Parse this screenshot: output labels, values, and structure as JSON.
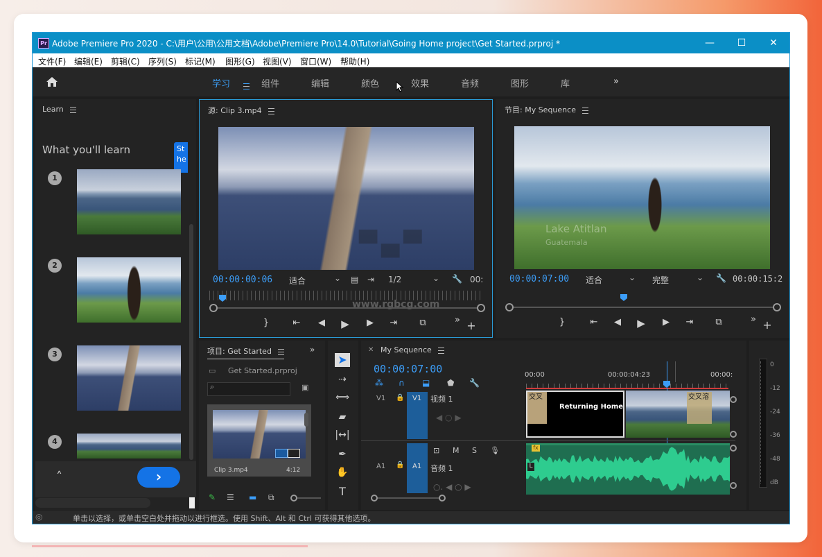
{
  "window": {
    "title": "Adobe Premiere Pro 2020 - C:\\用户\\公用\\公用文档\\Adobe\\Premiere Pro\\14.0\\Tutorial\\Going Home project\\Get Started.prproj *",
    "app_icon": "Pr",
    "controls": {
      "minimize": "—",
      "maximize": "☐",
      "close": "✕"
    }
  },
  "menu": [
    "文件(F)",
    "编辑(E)",
    "剪辑(C)",
    "序列(S)",
    "标记(M)",
    "图形(G)",
    "视图(V)",
    "窗口(W)",
    "帮助(H)"
  ],
  "workspaces": {
    "active": "学习",
    "items": [
      "组件",
      "编辑",
      "颜色",
      "效果",
      "音频",
      "图形",
      "库"
    ],
    "more": "»"
  },
  "learn_panel": {
    "title": "Learn",
    "heading": "What you'll learn",
    "tooltip": "St he",
    "steps": [
      "1",
      "2",
      "3",
      "4"
    ],
    "up_icon": "˄",
    "next_icon": "›"
  },
  "source_monitor": {
    "title": "源: Clip 3.mp4",
    "timecode": "00:00:00:06",
    "fit": "适合",
    "resolution": "1/2",
    "duration_partial": "00:",
    "watermark": "www.rgbcg.com"
  },
  "program_monitor": {
    "title": "节目: My Sequence",
    "timecode": "00:00:07:00",
    "fit": "适合",
    "quality": "完整",
    "duration": "00:00:15:2",
    "overlay_text_1": "Lake Atitlan",
    "overlay_text_2": "Guatemala"
  },
  "project_panel": {
    "title": "项目: Get Started",
    "file": "Get Started.prproj",
    "clip_name": "Clip 3.mp4",
    "clip_duration": "4:12",
    "more": "»"
  },
  "timeline": {
    "title": "My Sequence",
    "timecode": "00:00:07:00",
    "ruler": [
      "00:00",
      "00:00:04:23",
      "00:00:"
    ],
    "v1_src": "V1",
    "v1_target": "V1",
    "v1_name": "视频 1",
    "a1_src": "A1",
    "a1_target": "A1",
    "a1_name": "音频 1",
    "mute": "M",
    "solo": "S",
    "title_clip": "Returning Home",
    "transition_1": "交叉",
    "transition_2": "交叉溶",
    "audio_badge": "fx",
    "audio_label": "L"
  },
  "meters": [
    "0",
    "-12",
    "-24",
    "-36",
    "-48",
    "dB"
  ],
  "status_bar": "单击以选择，或单击空白处并拖动以进行框选。使用 Shift、Alt 和 Ctrl 可获得其他选项。",
  "colors": {
    "accent": "#3c9df7",
    "titlebar": "#0b8fc6",
    "audio_wave": "#2ecc8f"
  }
}
